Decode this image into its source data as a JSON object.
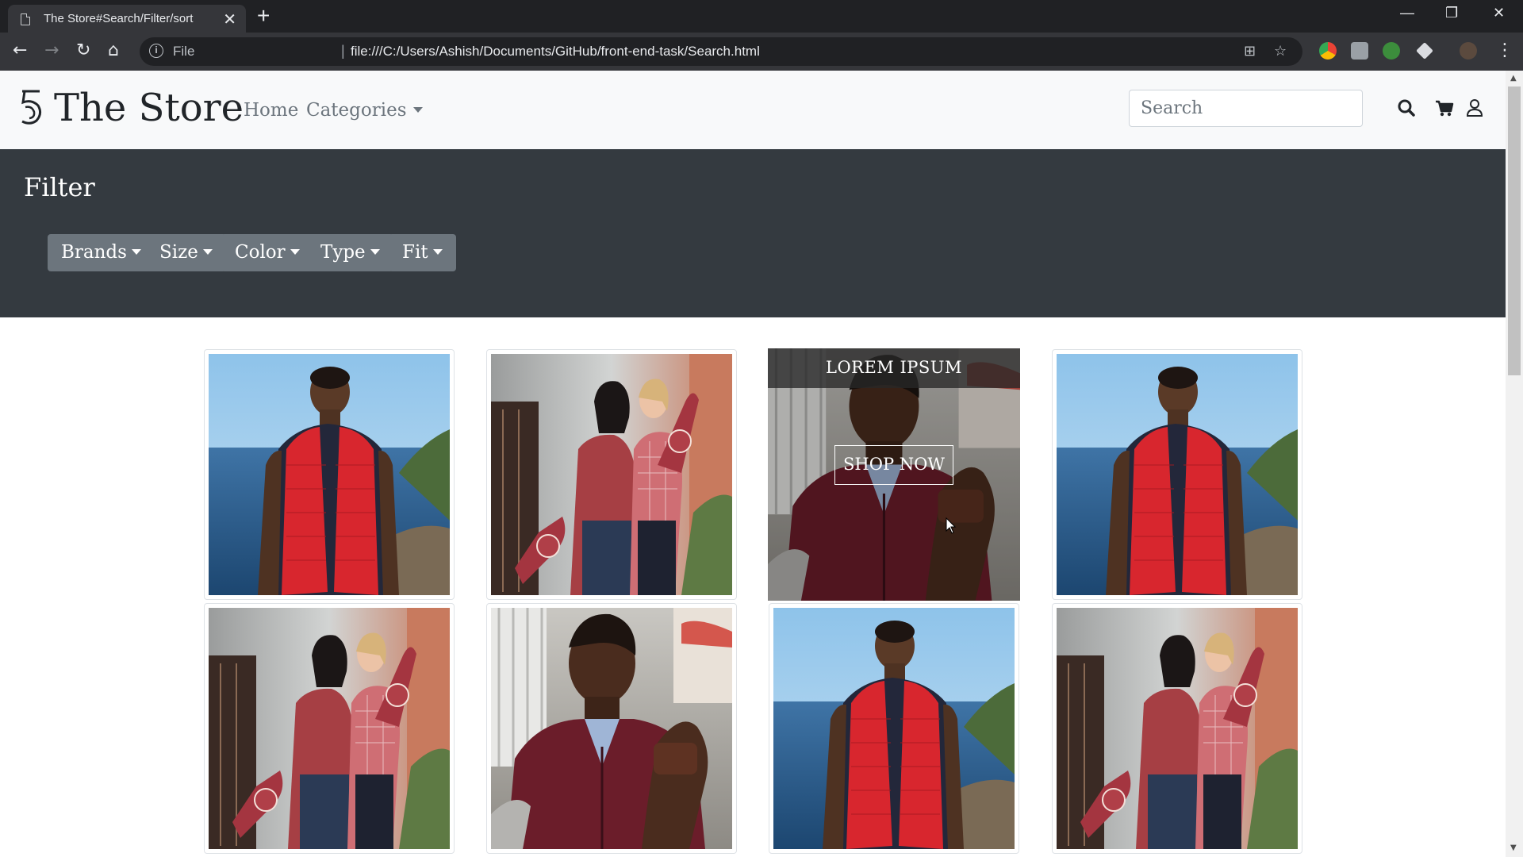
{
  "browser": {
    "tab_title": "The Store#Search/Filter/sort",
    "tab_close": "✕",
    "new_tab": "+",
    "omnibox_scheme": "File",
    "omnibox_sep": "|",
    "url": "file:///C:/Users/Ashish/Documents/GitHub/front-end-task/Search.html",
    "window_controls": [
      "—",
      "❐",
      "✕"
    ]
  },
  "navbar": {
    "brand": "The Store",
    "links": [
      {
        "label": "Home"
      },
      {
        "label": "Categories"
      }
    ],
    "search_placeholder": "Search"
  },
  "filter": {
    "title": "Filter",
    "buttons": [
      {
        "label": "Brands"
      },
      {
        "label": "Size"
      },
      {
        "label": "Color"
      },
      {
        "label": "Type"
      },
      {
        "label": "Fit"
      }
    ]
  },
  "products": {
    "hover_overlay": {
      "title": "LOREM IPSUM",
      "button": "SHOP NOW"
    },
    "grid": [
      {
        "image": "man-red-vest-ocean"
      },
      {
        "image": "two-women-foam-finger"
      },
      {
        "image": "man-maroon-pullover"
      },
      {
        "image": "man-red-vest-ocean"
      },
      {
        "image": "two-women-foam-finger"
      },
      {
        "image": "man-maroon-pullover"
      },
      {
        "image": "man-red-vest-ocean"
      },
      {
        "image": "two-women-foam-finger"
      }
    ]
  },
  "colors": {
    "navbar_bg": "#f8f9fa",
    "filter_band_bg": "#343a40",
    "filter_button_bg": "#6c757d",
    "browser_dark": "#202124"
  }
}
